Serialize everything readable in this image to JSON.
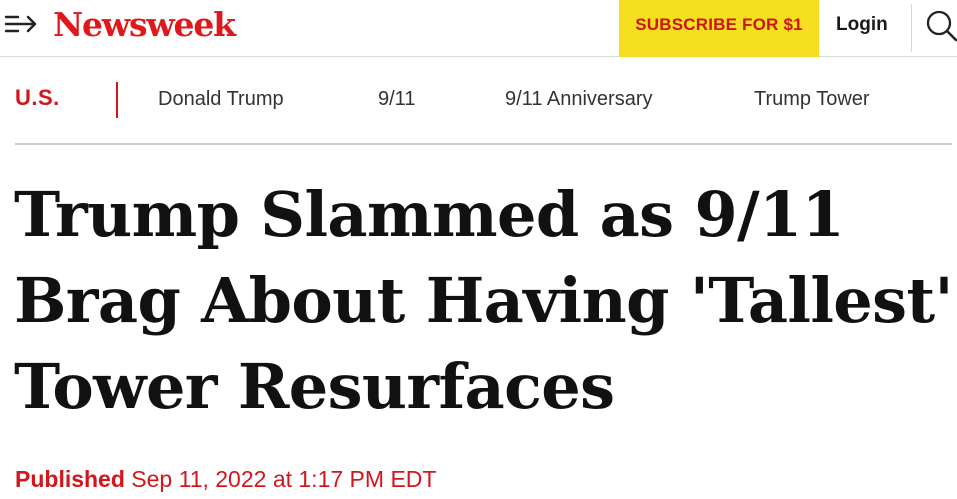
{
  "header": {
    "logo_text": "Newsweek",
    "subscribe_label": "SUBSCRIBE FOR $1",
    "login_label": "Login",
    "menu_icon": "menu-arrow-icon",
    "search_icon": "search-icon"
  },
  "tags": {
    "section": "U.S.",
    "items": [
      "Donald Trump",
      "9/11",
      "9/11 Anniversary",
      "Trump Tower"
    ]
  },
  "article": {
    "headline": "Trump Slammed as 9/11 Brag About Having 'Tallest' Tower Resurfaces",
    "published_label": "Published",
    "published_date": "Sep 11, 2022 at 1:17 PM EDT"
  },
  "colors": {
    "brand_red": "#e0181b",
    "subscribe_bg": "#f6df20",
    "accent_red": "#d3161b"
  }
}
